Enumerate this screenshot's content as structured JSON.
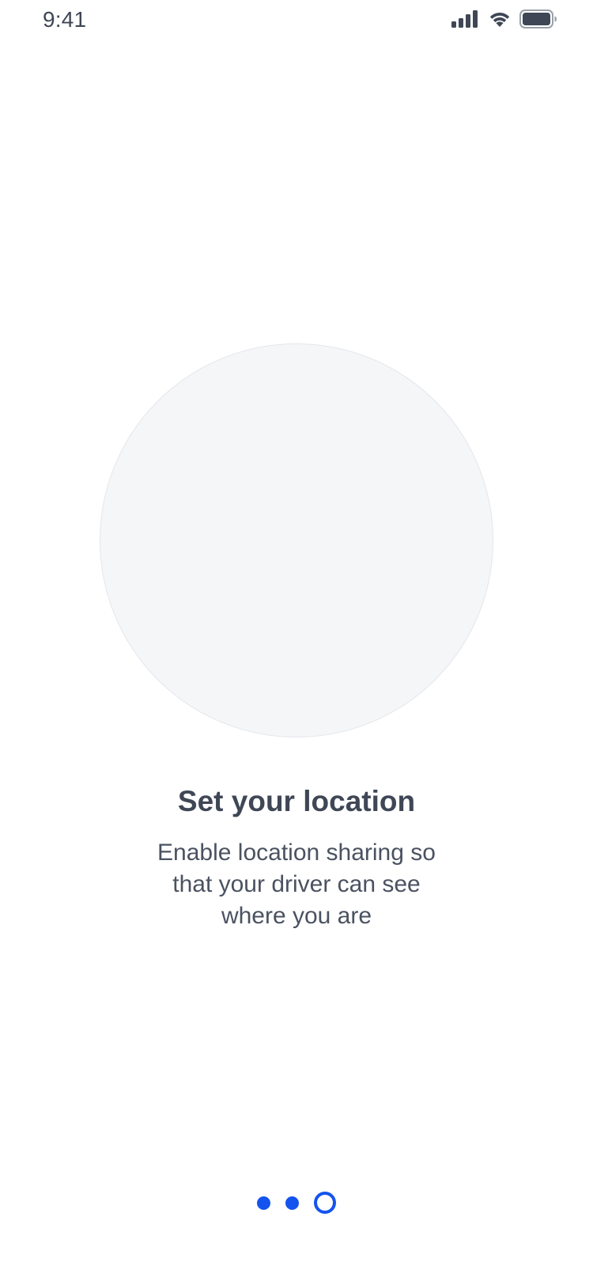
{
  "status_bar": {
    "time": "9:41",
    "icons": [
      "cellular-signal-icon",
      "wifi-icon",
      "battery-icon"
    ]
  },
  "onboarding": {
    "title": "Set your location",
    "description": "Enable location sharing so that your driver can see where you are"
  },
  "pagination": {
    "total_pages": 3,
    "current_page": 3
  },
  "colors": {
    "accent": "#1553ef",
    "text": "#3f4756",
    "illustration_fill": "#f5f6f8"
  }
}
